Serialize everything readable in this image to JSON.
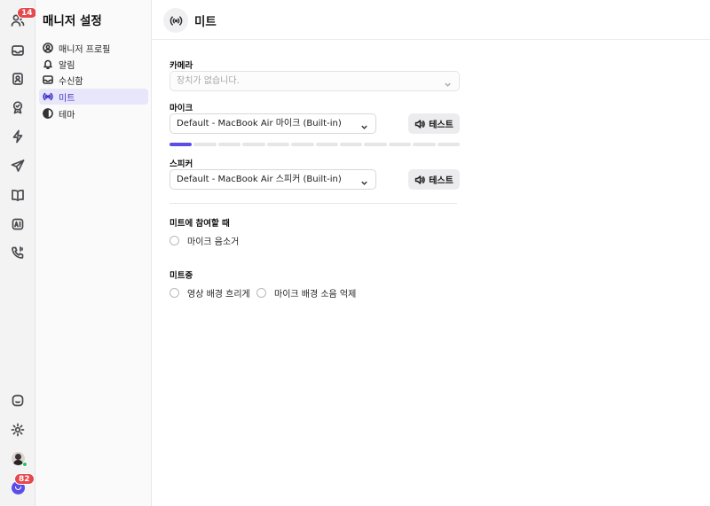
{
  "rail": {
    "people_badge": "14",
    "channel_badge": "82"
  },
  "nav": {
    "title": "매니저 설정",
    "items": [
      {
        "label": "매니저 프로필",
        "icon": "profile-icon"
      },
      {
        "label": "알림",
        "icon": "bell-icon"
      },
      {
        "label": "수신함",
        "icon": "inbox-icon"
      },
      {
        "label": "미트",
        "icon": "meet-icon",
        "active": true
      },
      {
        "label": "테마",
        "icon": "theme-icon"
      }
    ]
  },
  "header": {
    "title": "미트"
  },
  "camera": {
    "label": "카메라",
    "value": "장치가 없습니다."
  },
  "mic": {
    "label": "마이크",
    "value": "Default - MacBook Air 마이크 (Built-in)",
    "test_label": "테스트",
    "level": 0.0833
  },
  "speaker": {
    "label": "스피커",
    "value": "Default - MacBook Air 스피커 (Built-in)",
    "test_label": "테스트"
  },
  "join": {
    "title": "미트에 참여할 때",
    "options": [
      {
        "label": "마이크 음소거",
        "checked": false
      }
    ]
  },
  "during": {
    "title": "미트중",
    "options": [
      {
        "label": "영상 배경 흐리게",
        "checked": false
      },
      {
        "label": "마이크 배경 소음 억제",
        "checked": false
      }
    ]
  },
  "colors": {
    "accent": "#5b4ee8",
    "badge": "#e5484d",
    "online": "#22c55e"
  }
}
